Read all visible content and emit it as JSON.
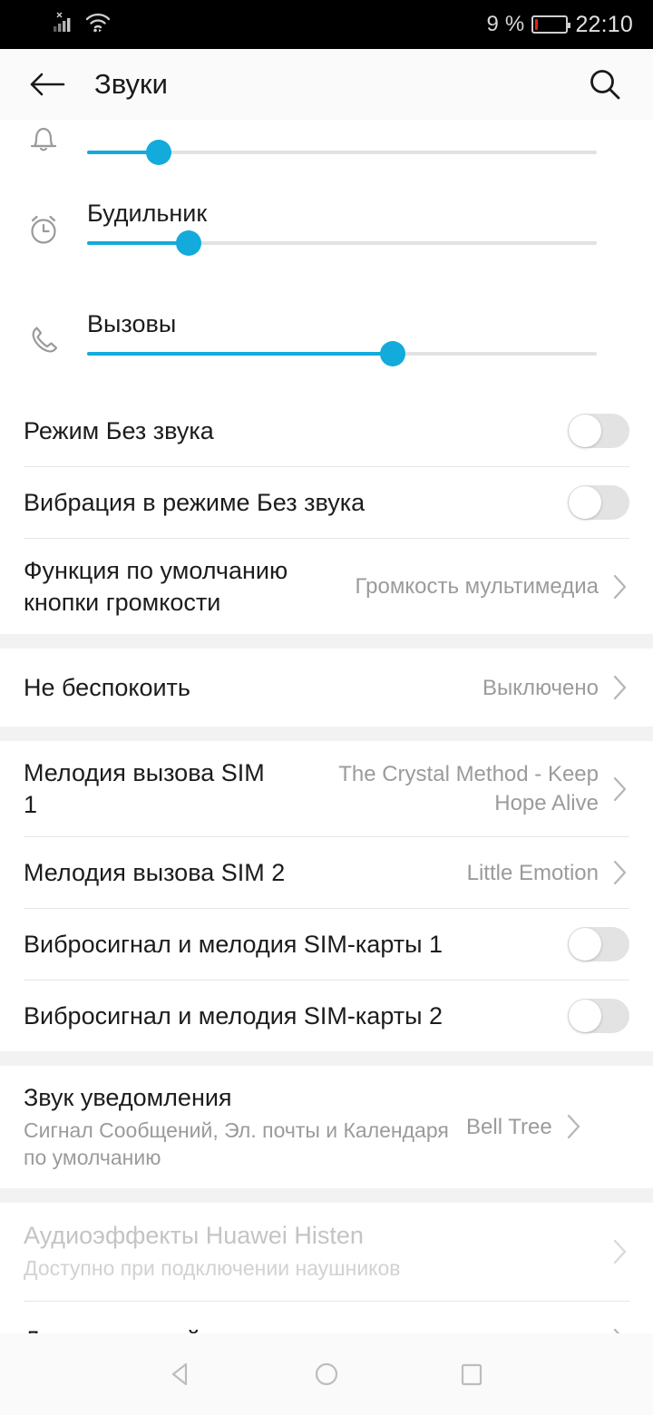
{
  "status_bar": {
    "signal_icon": "cellular-signal-no-service-icon",
    "wifi_icon": "wifi-icon",
    "battery_percent": "9 %",
    "battery_level": 9,
    "clock": "22:10"
  },
  "app_bar": {
    "back_icon": "back-arrow-icon",
    "title": "Звуки",
    "search_icon": "search-icon"
  },
  "volume_sliders": [
    {
      "icon": "bell-icon",
      "label": "",
      "value": 14,
      "clipped": true
    },
    {
      "icon": "alarm-clock-icon",
      "label": "Будильник",
      "value": 20,
      "clipped": false
    },
    {
      "icon": "phone-handset-icon",
      "label": "Вызовы",
      "value": 60,
      "clipped": false
    }
  ],
  "groups": [
    {
      "rows": [
        {
          "title": "Режим Без звука",
          "control": "switch",
          "on": false
        },
        {
          "title": "Вибрация в режиме Без звука",
          "control": "switch",
          "on": false
        },
        {
          "title": "Функция по умолчанию кнопки громкости",
          "value": "Громкость мультимедиа",
          "control": "chevron"
        }
      ]
    },
    {
      "rows": [
        {
          "title": "Не беспокоить",
          "value": "Выключено",
          "control": "chevron"
        }
      ]
    },
    {
      "rows": [
        {
          "title": "Мелодия вызова SIM 1",
          "value": "The Crystal Method - Keep Hope Alive",
          "control": "chevron"
        },
        {
          "title": "Мелодия вызова SIM 2",
          "value": "Little Emotion",
          "control": "chevron"
        },
        {
          "title": "Вибросигнал и мелодия SIM-карты 1",
          "control": "switch",
          "on": false
        },
        {
          "title": "Вибросигнал и мелодия SIM-карты 2",
          "control": "switch",
          "on": false
        }
      ]
    },
    {
      "rows": [
        {
          "title": "Звук уведомления",
          "subtitle": "Сигнал Сообщений, Эл. почты и Календаря по умолчанию",
          "value": "Bell Tree",
          "control": "chevron"
        }
      ]
    },
    {
      "rows": [
        {
          "title": "Аудиоэффекты Huawei Histen",
          "subtitle": "Доступно при подключении наушников",
          "control": "chevron",
          "disabled": true
        },
        {
          "title": "Другие настройки звука",
          "control": "chevron"
        }
      ]
    }
  ],
  "nav_bar": {
    "back_icon": "nav-back-triangle-icon",
    "home_icon": "nav-home-circle-icon",
    "recents_icon": "nav-recents-square-icon"
  },
  "colors": {
    "accent": "#12abdb",
    "battery_low": "#e62117",
    "section_gap": "#f2f2f2",
    "secondary_text": "#9b9b9b",
    "primary_text": "#1c1c1c"
  }
}
